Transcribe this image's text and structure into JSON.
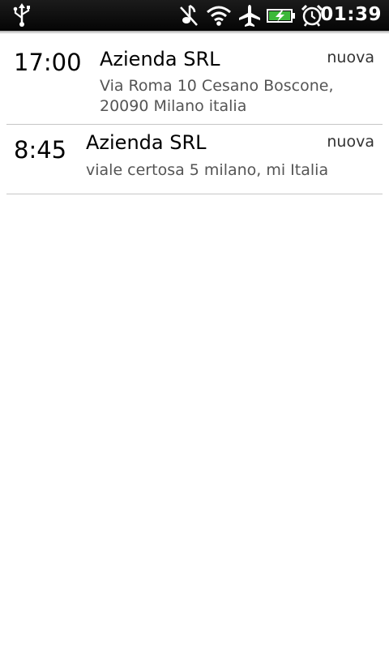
{
  "status_bar": {
    "time": "01:39",
    "icons": [
      "usb-icon",
      "silent-mode-icon",
      "wifi-icon",
      "airplane-mode-icon",
      "battery-charging-icon",
      "alarm-icon"
    ]
  },
  "appointments": [
    {
      "time": "17:00",
      "company": "Azienda SRL",
      "address": "Via Roma 10 Cesano Boscone, 20090 Milano italia",
      "status": "nuova"
    },
    {
      "time": "8:45",
      "company": "Azienda SRL",
      "address": "viale certosa 5 milano,  mi Italia",
      "status": "nuova"
    }
  ],
  "colors": {
    "status_bar_bg": "#0a0a0a",
    "divider": "#c6c6c6",
    "address_text": "#555555"
  }
}
